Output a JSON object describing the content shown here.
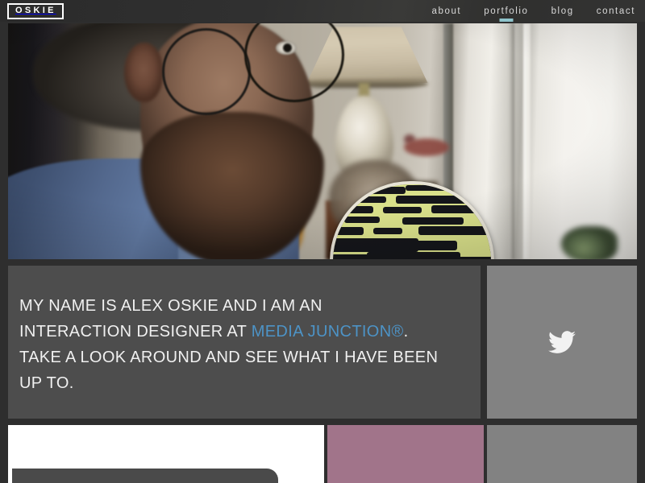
{
  "site": {
    "logo_text": "OSKIE",
    "nav_bg": "#2d2d2d",
    "panel_bg": "#4d4d4d",
    "accent_link": "#4d93c6",
    "active_indicator": "#8fc4cc",
    "tile_pink": "#a1748a",
    "tile_grey": "#828282",
    "tile_white": "#ffffff"
  },
  "nav": {
    "items": [
      {
        "label": "about",
        "active": false
      },
      {
        "label": "portfolio",
        "active": true
      },
      {
        "label": "blog",
        "active": false
      },
      {
        "label": "contact",
        "active": false
      }
    ]
  },
  "hero": {
    "alt": "Close-up photo of a bearded man wearing glasses and a blue denim shirt, holding a yellow-green camouflage skateboard deck in a living room with a lamp in the background",
    "icon_name": "hero-photo"
  },
  "intro": {
    "line1": "MY NAME IS ALEX OSKIE AND I AM AN",
    "line2_before": "INTERACTION DESIGNER AT ",
    "link_text": "MEDIA JUNCTION®",
    "line2_after": ".",
    "line3": "TAKE A LOOK AROUND AND SEE WHAT I HAVE BEEN",
    "line4": "UP TO."
  },
  "social": {
    "icon_name": "twitter-bird-icon",
    "label": "Twitter",
    "icon_color": "#f2f2f2"
  },
  "tiles": [
    {
      "name": "tile-white",
      "color": "#ffffff",
      "label": ""
    },
    {
      "name": "tile-pink",
      "color": "#a1748a",
      "label": ""
    },
    {
      "name": "tile-grey",
      "color": "#828282",
      "label": ""
    }
  ]
}
